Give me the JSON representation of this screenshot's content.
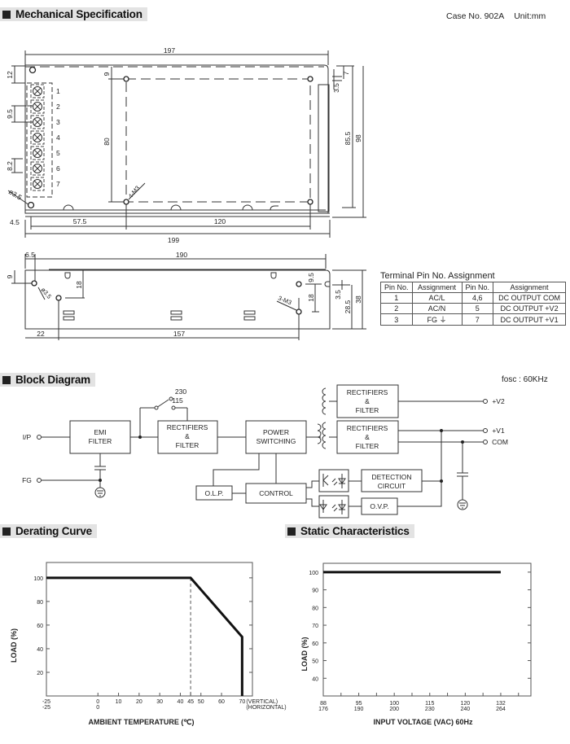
{
  "header": {
    "case_no": "Case No. 902A",
    "unit": "Unit:mm"
  },
  "sections": {
    "mechanical": "Mechanical Specification",
    "block": "Block Diagram",
    "derating": "Derating Curve",
    "static": "Static Characteristics"
  },
  "mechanical": {
    "top_view": {
      "dims": {
        "overall_top": "197",
        "overall_bottom": "199",
        "left_margin": "4.5",
        "hole_offset": "57.5",
        "hole_spacing": "120",
        "top_edge": "12",
        "hole_top": "9",
        "hole_vertical": "80",
        "pin_pitch": "9.5",
        "pin_width": "8.2",
        "side_85": "85.5",
        "side_98": "98",
        "side_7": "7",
        "side_35": "3.5",
        "hole_dia": "ø3.5",
        "screw_note": "4-M3"
      },
      "pins": [
        "1",
        "2",
        "3",
        "4",
        "5",
        "6",
        "7"
      ]
    },
    "side_view": {
      "dims": {
        "overall": "190",
        "left_offset": "6.5",
        "hole_top": "9",
        "hole_depth": "18",
        "right_top": "9.5",
        "right_depth": "18",
        "bottom_left": "22",
        "bottom_span": "157",
        "side_35": "3.5",
        "side_285": "28.5",
        "side_38": "38",
        "hole_dia": "ø3.5",
        "screw_note": "3-M3"
      }
    },
    "pin_table": {
      "title": "Terminal Pin No.  Assignment",
      "headers": [
        "Pin No.",
        "Assignment",
        "Pin No.",
        "Assignment"
      ],
      "rows": [
        [
          "1",
          "AC/L",
          "4,6",
          "DC OUTPUT COM"
        ],
        [
          "2",
          "AC/N",
          "5",
          "DC OUTPUT +V2"
        ],
        [
          "3",
          "FG ⏚",
          "7",
          "DC OUTPUT +V1"
        ]
      ]
    }
  },
  "block_diagram": {
    "fosc": "fosc : 60KHz",
    "inputs": {
      "ip": "I/P",
      "fg": "FG"
    },
    "switch": {
      "v230": "230",
      "v115": "115"
    },
    "blocks": {
      "emi": [
        "EMI",
        "FILTER"
      ],
      "rect_in": [
        "RECTIFIERS",
        "&",
        "FILTER"
      ],
      "power": [
        "POWER",
        "SWITCHING"
      ],
      "rect_v2": [
        "RECTIFIERS",
        "&",
        "FILTER"
      ],
      "rect_v1": [
        "RECTIFIERS",
        "&",
        "FILTER"
      ],
      "olp": "O.L.P.",
      "control": "CONTROL",
      "detection": [
        "DETECTION",
        "CIRCUIT"
      ],
      "ovp": "O.V.P."
    },
    "outputs": {
      "v2": "+V2",
      "v1": "+V1",
      "com": "COM"
    }
  },
  "chart_data": [
    {
      "type": "line",
      "title": "Derating Curve",
      "xlabel": "AMBIENT TEMPERATURE (℃)",
      "ylabel": "LOAD (%)",
      "x": [
        -25,
        45,
        70,
        70
      ],
      "y": [
        100,
        100,
        50,
        0
      ],
      "xlim": [
        -25,
        75
      ],
      "ylim": [
        0,
        113
      ],
      "yticks": [
        20,
        40,
        60,
        80,
        100
      ],
      "xticks_vertical": [
        "-25",
        "0",
        "10",
        "20",
        "30",
        "40",
        "45",
        "50",
        "60",
        "70"
      ],
      "xtick_values": [
        -25,
        0,
        10,
        20,
        30,
        40,
        45,
        50,
        60,
        70
      ],
      "xticks_horizontal": [
        "-25",
        "0"
      ],
      "suffix_vertical": "(VERTICAL)",
      "suffix_horizontal": "(HORIZONTAL)",
      "reference_line_x": 45,
      "grid": false
    },
    {
      "type": "line",
      "title": "Static Characteristics",
      "xlabel": "INPUT VOLTAGE (VAC) 60Hz",
      "ylabel": "LOAD (%)",
      "x_index": [
        0,
        5
      ],
      "y": [
        100,
        100
      ],
      "ylim": [
        30,
        105
      ],
      "yticks": [
        40,
        50,
        60,
        70,
        80,
        90,
        100
      ],
      "xticks_top": [
        "88",
        "95",
        "100",
        "115",
        "120",
        "132"
      ],
      "xticks_bottom": [
        "176",
        "190",
        "200",
        "230",
        "240",
        "264"
      ],
      "grid": false
    }
  ]
}
